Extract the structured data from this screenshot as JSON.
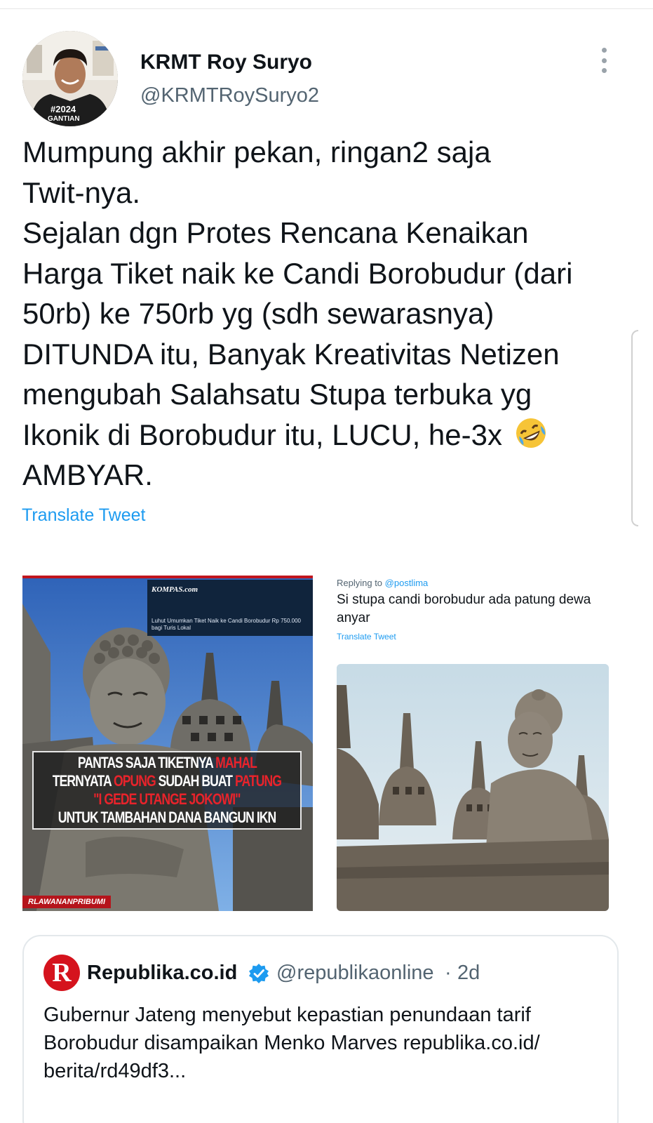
{
  "tweet": {
    "display_name": "KRMT Roy Suryo",
    "handle": "@KRMTRoySuryo2",
    "avatar_shirt_text": "#2024 GANTIAN",
    "text": "Mumpung akhir pekan, ringan2 saja\nTwit-nya.\nSejalan dgn Protes Rencana Kenaikan\nHarga Tiket naik ke Candi Borobudur (dari\n50rb) ke 750rb yg (sdh sewarasnya)\nDITUNDA itu, Banyak Kreativitas Netizen\nmengubah Salahsatu Stupa terbuka yg\nIkonik di Borobudur itu, LUCU, he-3x",
    "text_end": "AMBYAR.",
    "emoji": "rolling-on-floor-laughing",
    "translate_label": "Translate Tweet"
  },
  "media_left": {
    "site_logo": "KOMPAS.com",
    "site_headline": "Luhut Umumkan Tiket Naik ke Candi Borobudur Rp 750.000 bagi Turis Lokal",
    "caption": {
      "line1_a": "PANTAS SAJA TIKETNYA ",
      "line1_b": "MAHAL",
      "line2_a": "TERNYATA ",
      "line2_b": "OPUNG",
      "line2_c": " SUDAH BUAT ",
      "line2_d": "PATUNG",
      "line3": "\"I GEDE UTANGE JOKOWI\"",
      "line4": "UNTUK TAMBAHAN DANA BANGUN IKN"
    },
    "watermark": "RLAWANANPRIBUMI"
  },
  "media_right": {
    "reply_prefix": "Replying to ",
    "reply_mention": "@postlima",
    "text": "Si stupa candi borobudur ada patung dewa anyar",
    "translate_label": "Translate Tweet"
  },
  "quote": {
    "logo_letter": "R",
    "name": "Republika.co.id",
    "handle": "@republikaonline",
    "separator": "·",
    "time": "2d",
    "text": "Gubernur Jateng menyebut kepastian penundaan tarif Borobudur disampaikan Menko Marves republika.co.id/ berita/rd49df3..."
  },
  "colors": {
    "link": "#1d9bf0",
    "secondary_text": "#536471",
    "republika_red": "#d5131d",
    "caption_red": "#e8232b"
  }
}
